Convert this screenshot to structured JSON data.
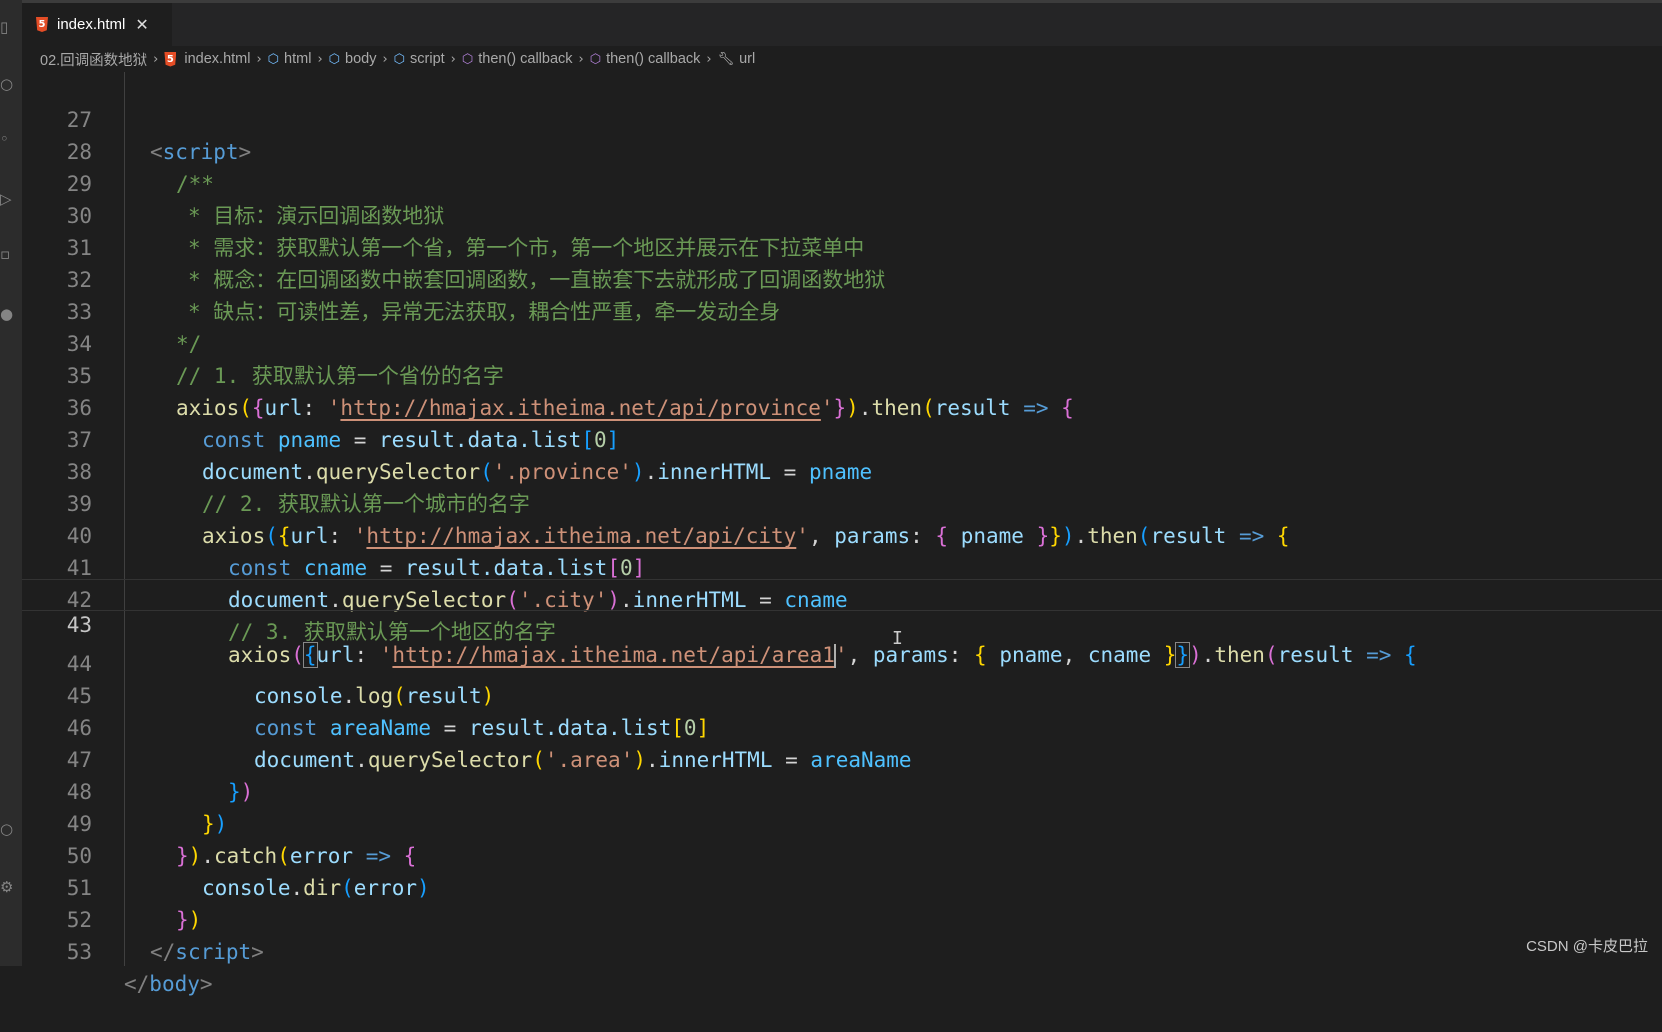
{
  "tab": {
    "filename": "index.html",
    "close_glyph": "✕",
    "icon": "html5-icon"
  },
  "breadcrumb": [
    "02.回调函数地狱",
    "index.html",
    "html",
    "body",
    "script",
    "then() callback",
    "then() callback",
    "url"
  ],
  "lines": [
    {
      "n": "27"
    },
    {
      "n": "28"
    },
    {
      "n": "29"
    },
    {
      "n": "30"
    },
    {
      "n": "31"
    },
    {
      "n": "32"
    },
    {
      "n": "33"
    },
    {
      "n": "34"
    },
    {
      "n": "35"
    },
    {
      "n": "36"
    },
    {
      "n": "37"
    },
    {
      "n": "38"
    },
    {
      "n": "39"
    },
    {
      "n": "40"
    },
    {
      "n": "41"
    },
    {
      "n": "42"
    },
    {
      "n": "43"
    },
    {
      "n": "44"
    },
    {
      "n": "45"
    },
    {
      "n": "46"
    },
    {
      "n": "47"
    },
    {
      "n": "48"
    },
    {
      "n": "49"
    },
    {
      "n": "50"
    },
    {
      "n": "51"
    },
    {
      "n": "52"
    },
    {
      "n": "53"
    }
  ],
  "code": {
    "script_open": "script",
    "c_open": "/**",
    "c_goal": "* 目标：演示回调函数地狱",
    "c_need": "* 需求：获取默认第一个省，第一个市，第一个地区并展示在下拉菜单中",
    "c_concept": "* 概念：在回调函数中嵌套回调函数，一直嵌套下去就形成了回调函数地狱",
    "c_cons": "* 缺点：可读性差，异常无法获取，耦合性严重，牵一发动全身",
    "c_close": "*/",
    "c_step1": "// 1. 获取默认第一个省份的名字",
    "c_step2": "// 2. 获取默认第一个城市的名字",
    "c_step3": "// 3. 获取默认第一个地区的名字",
    "axios": "axios",
    "url_key": "url",
    "url_province": "http://hmajax.itheima.net/api/province",
    "url_city": "http://hmajax.itheima.net/api/city",
    "url_area": "http://hmajax.itheima.net/api/area1",
    "then": "then",
    "result": "result",
    "const": "const",
    "pname": "pname",
    "cname": "cname",
    "areaName": "areaName",
    "result_data_list": "result.data.list",
    "zero": "0",
    "document": "document",
    "querySelector": "querySelector",
    "innerHTML": "innerHTML",
    "sel_province": "'.province'",
    "sel_city": "'.city'",
    "sel_area": "'.area'",
    "params": "params",
    "console": "console",
    "log": "log",
    "dir": "dir",
    "catch": "catch",
    "error": "error",
    "script_close": "script",
    "body_close": "body"
  },
  "watermark": "CSDN @卡皮巴拉",
  "colors": {
    "background": "#1e1e1e",
    "comment": "#6a9955",
    "string": "#ce9178",
    "keyword": "#569cd6",
    "function": "#dcdcaa",
    "variable": "#9cdcfe"
  }
}
